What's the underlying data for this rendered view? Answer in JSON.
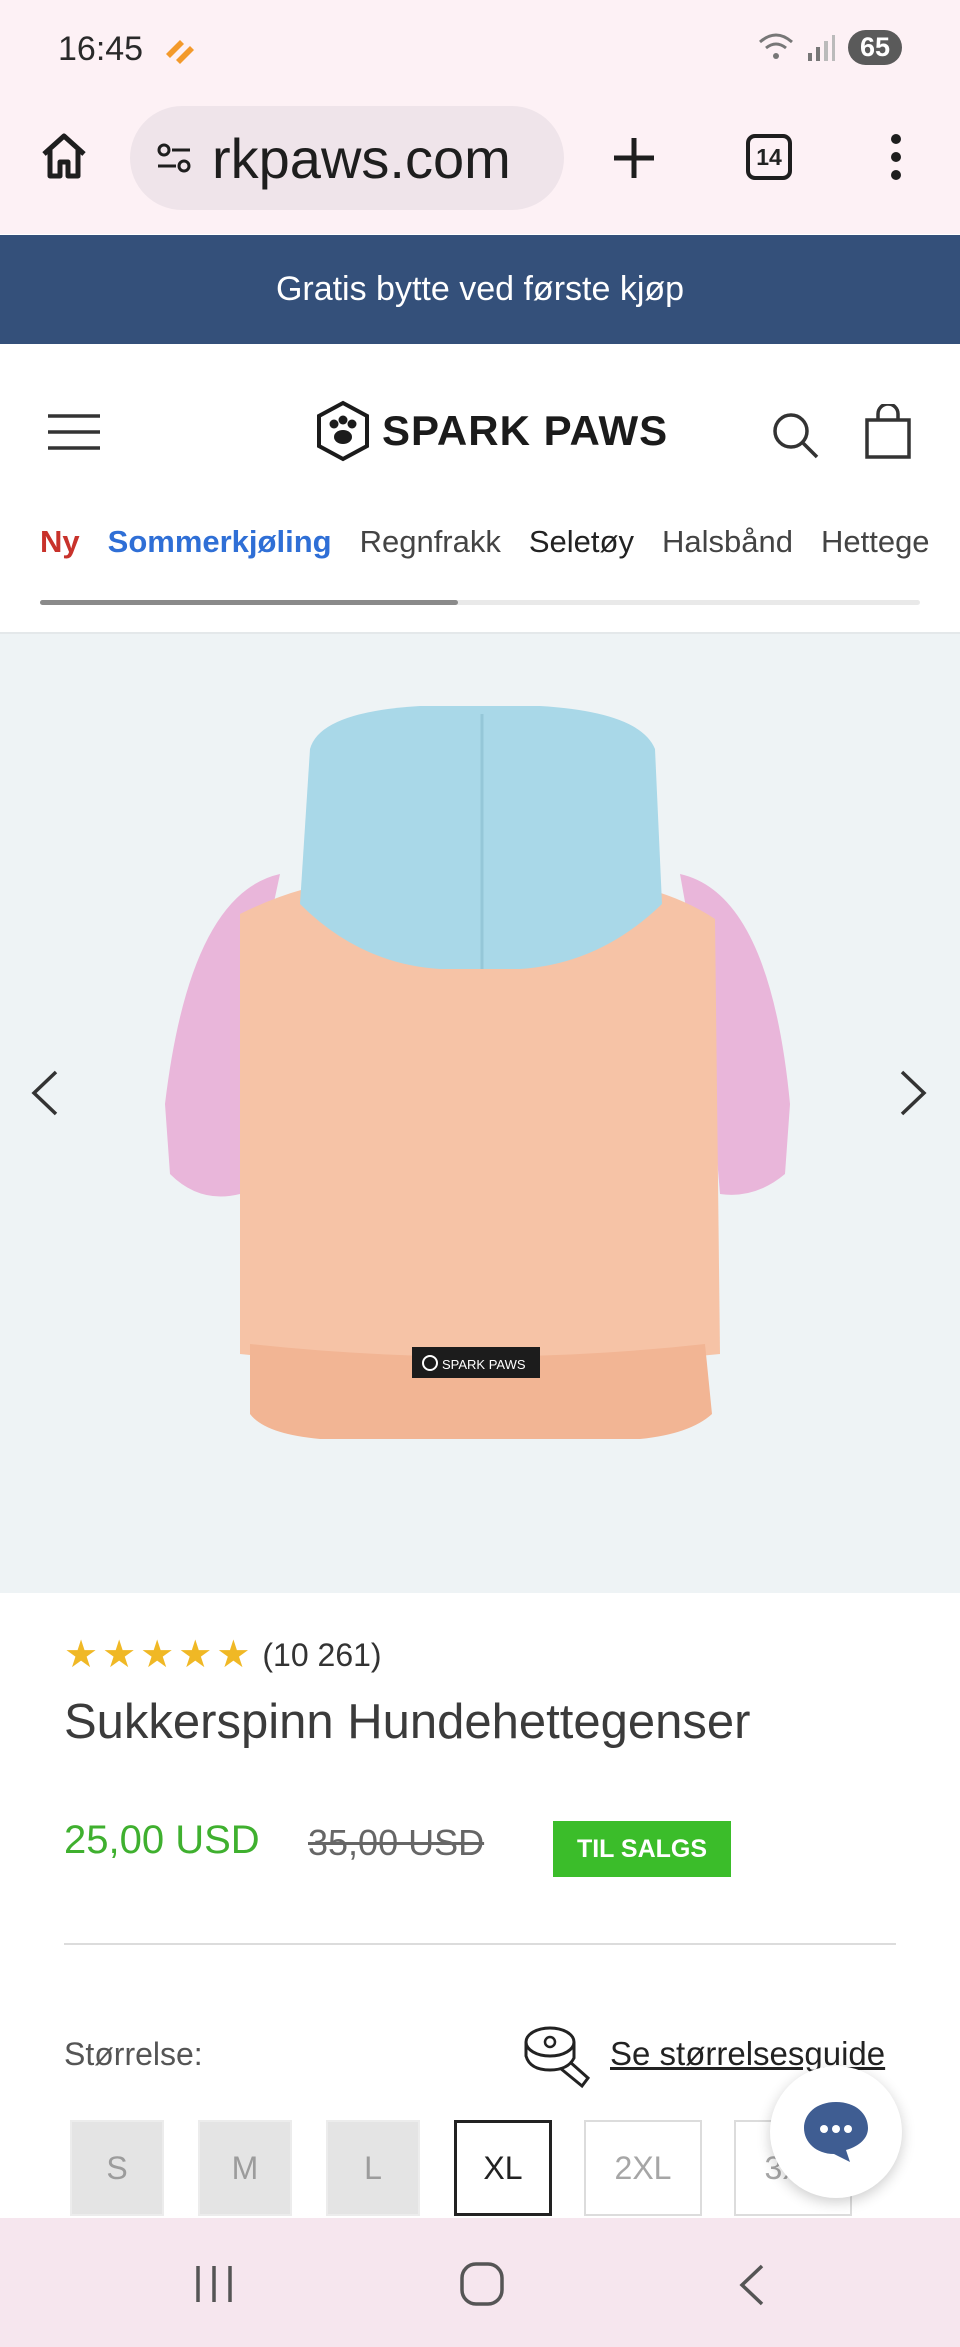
{
  "status_bar": {
    "time": "16:45",
    "battery": "65"
  },
  "browser": {
    "url": "rkpaws.com",
    "tab_count": "14"
  },
  "promo_banner": {
    "text": "Gratis bytte ved første kjøp"
  },
  "header": {
    "logo_text": "SPARK PAWS"
  },
  "nav": {
    "items": [
      {
        "label": "Ny",
        "color": "#c8322b"
      },
      {
        "label": "Sommerkjøling",
        "color": "#2f6fd6"
      },
      {
        "label": "Regnfrakk",
        "color": "#444444"
      },
      {
        "label": "Seletøy",
        "color": "#222222"
      },
      {
        "label": "Halsbånd",
        "color": "#444444"
      },
      {
        "label": "Hettege",
        "color": "#444444"
      }
    ],
    "scroll_fraction": 0.475
  },
  "product": {
    "rating_stars": 5,
    "review_count": "(10 261)",
    "title": "Sukkerspinn Hundehettegenser",
    "price": "25,00 USD",
    "old_price": "35,00 USD",
    "sale_badge": "TIL SALGS",
    "label_text": "SPARK PAWS",
    "colors": {
      "hood": "#a9d8e8",
      "body": "#f6c3a6",
      "sleeve": "#e9b6da",
      "price_green": "#3fb02f"
    }
  },
  "size": {
    "label": "Størrelse:",
    "guide_link": "Se størrelsesguide",
    "options": [
      {
        "label": "S",
        "state": "disabled"
      },
      {
        "label": "M",
        "state": "disabled"
      },
      {
        "label": "L",
        "state": "disabled"
      },
      {
        "label": "XL",
        "state": "selected"
      },
      {
        "label": "2XL",
        "state": "available"
      },
      {
        "label": "3XL",
        "state": "available"
      }
    ]
  }
}
